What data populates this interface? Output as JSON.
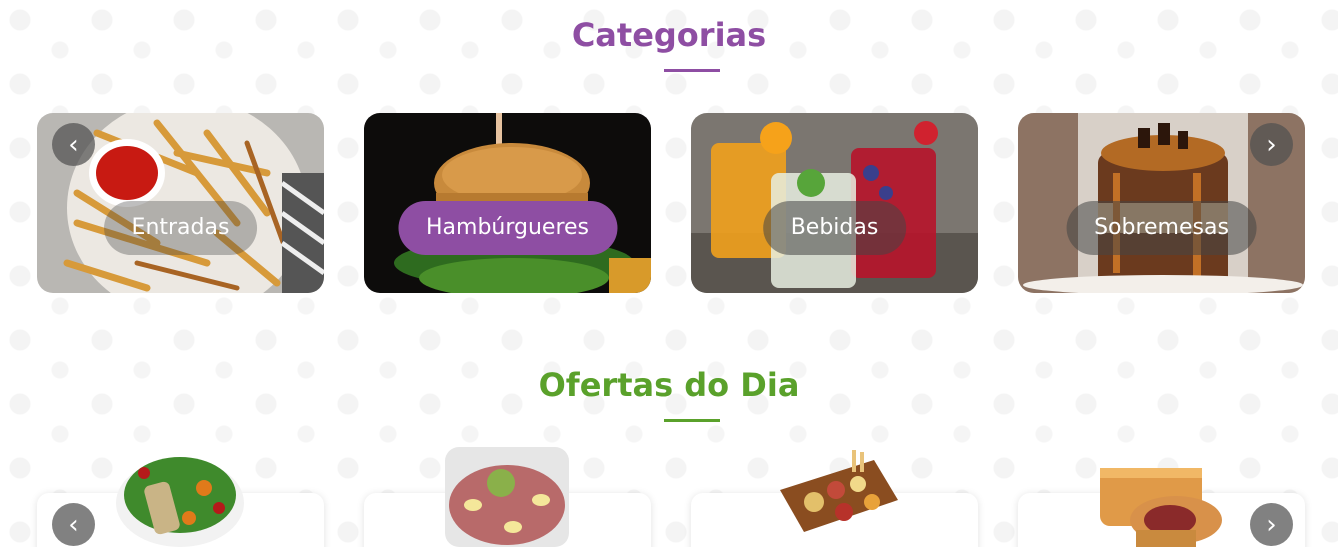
{
  "categorias": {
    "title": "Categorias",
    "items": [
      {
        "label": "Entradas"
      },
      {
        "label": "Hambúrgueres"
      },
      {
        "label": "Bebidas"
      },
      {
        "label": "Sobremesas"
      }
    ]
  },
  "ofertas": {
    "title": "Ofertas do Dia"
  },
  "icons": {
    "prev": "chevron-left-icon",
    "next": "chevron-right-icon"
  },
  "colors": {
    "accent_purple": "#8e4ea3",
    "accent_green": "#5aa12b"
  }
}
